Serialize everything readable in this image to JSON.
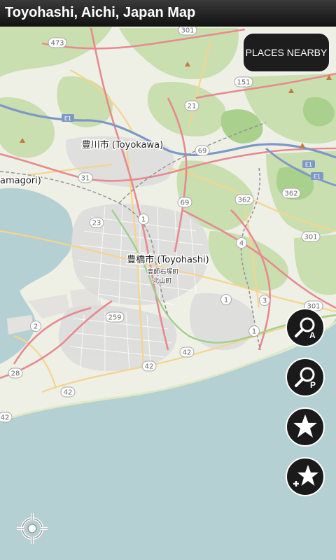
{
  "app": {
    "title": "Toyohashi, Aichi, Japan Map"
  },
  "buttons": {
    "places_nearby": "PLACES NEARBY",
    "search_address_badge": "A",
    "search_places_badge": "P"
  },
  "map": {
    "labels": {
      "toyokawa": "豊川市 (Toyokawa)",
      "toyohashi": "豊橋市 (Toyohashi)",
      "gamagori": "amagori)",
      "takashi": "高師石塚町",
      "kitayama": "北山町"
    },
    "road_shields": [
      {
        "id": "r473",
        "text": "473"
      },
      {
        "id": "r301a",
        "text": "301"
      },
      {
        "id": "r151",
        "text": "151"
      },
      {
        "id": "r21",
        "text": "21"
      },
      {
        "id": "r69a",
        "text": "69"
      },
      {
        "id": "r31",
        "text": "31"
      },
      {
        "id": "r362a",
        "text": "362"
      },
      {
        "id": "r362b",
        "text": "362"
      },
      {
        "id": "r23",
        "text": "23"
      },
      {
        "id": "r1a",
        "text": "1"
      },
      {
        "id": "r69b",
        "text": "69"
      },
      {
        "id": "r301b",
        "text": "301"
      },
      {
        "id": "r4",
        "text": "4"
      },
      {
        "id": "r259",
        "text": "259"
      },
      {
        "id": "r1b",
        "text": "1"
      },
      {
        "id": "r3",
        "text": "3"
      },
      {
        "id": "r301c",
        "text": "301"
      },
      {
        "id": "r2",
        "text": "2"
      },
      {
        "id": "r1c",
        "text": "1"
      },
      {
        "id": "r42a",
        "text": "42"
      },
      {
        "id": "r42b",
        "text": "42"
      },
      {
        "id": "r28",
        "text": "28"
      },
      {
        "id": "r42c",
        "text": "42"
      },
      {
        "id": "r42d",
        "text": "42"
      }
    ],
    "expressway_labels": [
      {
        "id": "e1",
        "text": "E1"
      },
      {
        "id": "e2",
        "text": "E1"
      },
      {
        "id": "e3",
        "text": "E1"
      }
    ]
  }
}
